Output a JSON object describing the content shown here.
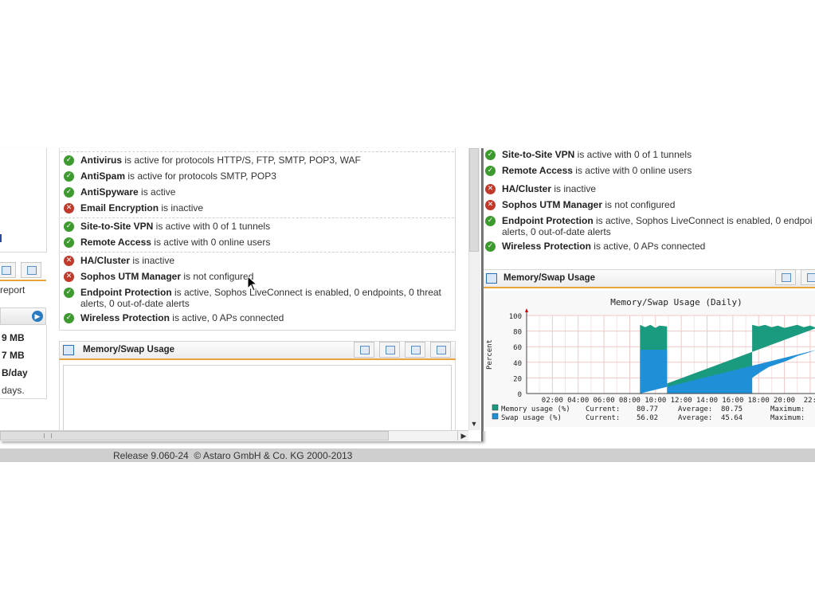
{
  "left_window": {
    "status_groups": [
      [
        {
          "status": "ok",
          "name": "Antivirus",
          "text": " is active for protocols HTTP/S, FTP, SMTP, POP3, WAF"
        },
        {
          "status": "ok",
          "name": "AntiSpam",
          "text": " is active for protocols SMTP, POP3"
        },
        {
          "status": "ok",
          "name": "AntiSpyware",
          "text": " is active"
        },
        {
          "status": "error",
          "name": "Email Encryption",
          "text": " is inactive"
        }
      ],
      [
        {
          "status": "ok",
          "name": "Site-to-Site VPN",
          "text": " is active with 0 of 1 tunnels"
        },
        {
          "status": "ok",
          "name": "Remote Access",
          "text": " is active with 0 online users"
        }
      ],
      [
        {
          "status": "error",
          "name": "HA/Cluster",
          "text": " is inactive"
        },
        {
          "status": "error",
          "name": "Sophos UTM Manager",
          "text": " is not configured"
        },
        {
          "status": "ok",
          "name": "Endpoint Protection",
          "text": " is active, Sophos LiveConnect is enabled, 0 endpoints, 0 threat",
          "text2": "alerts, 0 out-of-date alerts"
        },
        {
          "status": "ok",
          "name": "Wireless Protection",
          "text": " is active, 0 APs connected"
        }
      ]
    ],
    "left_column": {
      "report_link": "report",
      "values": [
        "9 MB",
        "7 MB",
        "B/day"
      ],
      "days_text": "days."
    },
    "memory_panel": {
      "title": "Memory/Swap Usage"
    }
  },
  "right_window": {
    "statuses": [
      {
        "status": "ok",
        "name": "Site-to-Site VPN",
        "text": " is active with 0 of 1 tunnels"
      },
      {
        "status": "ok",
        "name": "Remote Access",
        "text": " is active with 0 online users"
      },
      {
        "status": "error",
        "name": "HA/Cluster",
        "text": " is inactive"
      },
      {
        "status": "error",
        "name": "Sophos UTM Manager",
        "text": " is not configured"
      },
      {
        "status": "ok",
        "name": "Endpoint Protection",
        "text": " is active, Sophos LiveConnect is enabled, 0 endpoi",
        "text2": "alerts, 0 out-of-date alerts"
      },
      {
        "status": "ok",
        "name": "Wireless Protection",
        "text": " is active, 0 APs connected"
      }
    ],
    "memory_panel": {
      "title": "Memory/Swap Usage"
    }
  },
  "chart_data": {
    "type": "area",
    "title": "Memory/Swap Usage (Daily)",
    "ylabel": "Percent",
    "ylim": [
      0,
      100
    ],
    "yticks": [
      0,
      20,
      40,
      60,
      80,
      100
    ],
    "xticks": [
      "02:00",
      "04:00",
      "06:00",
      "08:00",
      "10:00",
      "12:00",
      "14:00",
      "16:00",
      "18:00",
      "20:00",
      "22:"
    ],
    "xlim_hours": [
      0,
      22.5
    ],
    "colors": {
      "memory": "#1a9a7e",
      "swap": "#1f8fd8"
    },
    "series": [
      {
        "name": "Memory usage (%)",
        "current": "80.77",
        "average": "80.75",
        "maximum": "",
        "points": [
          [
            8.8,
            0
          ],
          [
            8.8,
            88
          ],
          [
            9.2,
            85
          ],
          [
            9.6,
            88
          ],
          [
            10.0,
            84
          ],
          [
            10.3,
            87
          ],
          [
            10.9,
            86
          ],
          [
            10.9,
            0
          ],
          [
            17.5,
            0
          ],
          [
            17.5,
            88
          ],
          [
            18.0,
            86
          ],
          [
            18.5,
            88
          ],
          [
            19.0,
            85
          ],
          [
            19.5,
            87
          ],
          [
            20.0,
            84
          ],
          [
            20.5,
            86
          ],
          [
            21.0,
            88
          ],
          [
            21.5,
            85
          ],
          [
            22.0,
            87
          ],
          [
            22.5,
            84
          ]
        ]
      },
      {
        "name": "Swap usage (%)",
        "current": "56.02",
        "average": "45.64",
        "maximum": "",
        "points": [
          [
            8.8,
            0
          ],
          [
            8.8,
            56
          ],
          [
            9.5,
            56
          ],
          [
            10.5,
            56
          ],
          [
            10.9,
            56
          ],
          [
            10.9,
            0
          ],
          [
            17.5,
            0
          ],
          [
            17.5,
            20
          ],
          [
            18.2,
            28
          ],
          [
            18.8,
            34
          ],
          [
            19.5,
            38
          ],
          [
            20.2,
            42
          ],
          [
            21.0,
            48
          ],
          [
            21.8,
            52
          ],
          [
            22.5,
            56
          ]
        ]
      }
    ],
    "legend_labels": {
      "current": "Current:",
      "average": "Average:",
      "maximum": "Maximum:"
    }
  },
  "footer": {
    "release": "Release 9.060-24  © Astaro GmbH & Co. KG 2000-2013"
  }
}
